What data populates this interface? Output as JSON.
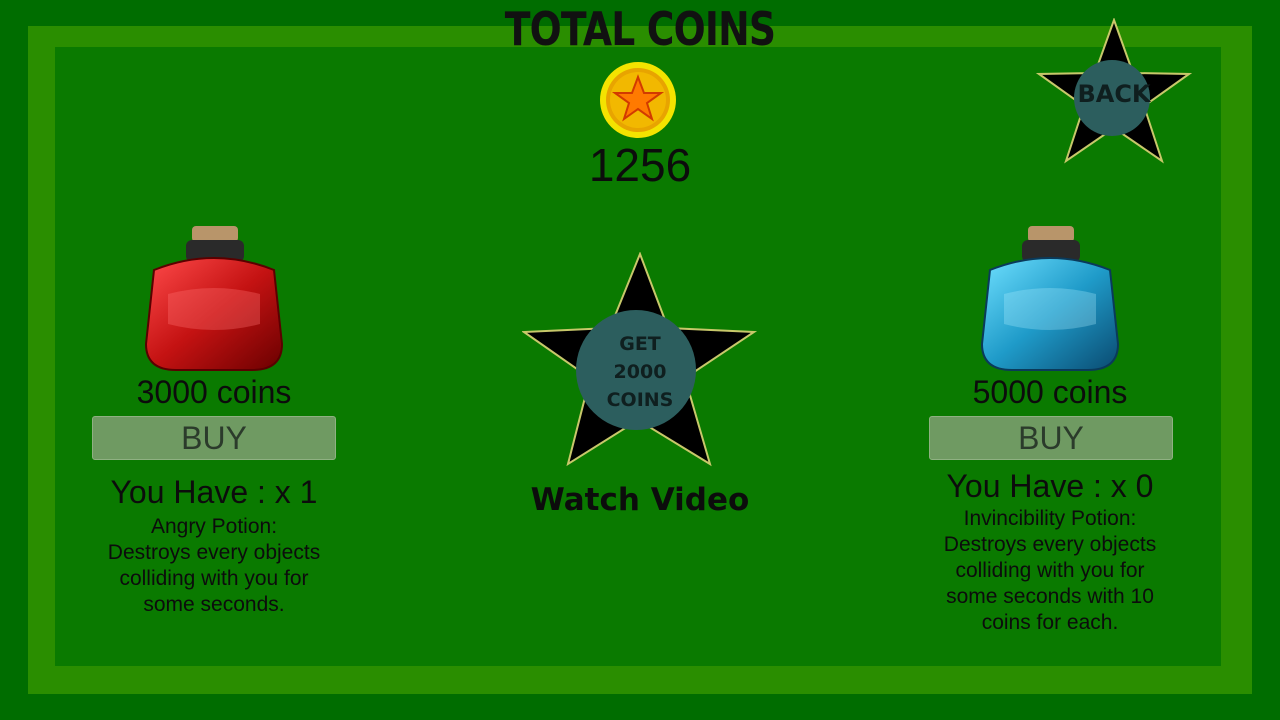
{
  "header": {
    "title": "TOTAL COINS",
    "coin_count": "1256"
  },
  "back_button": {
    "label": "BACK"
  },
  "video_offer": {
    "button_label": "GET\n2000\nCOINS",
    "caption": "Watch Video"
  },
  "shop_items": [
    {
      "price": "3000 coins",
      "buy_label": "BUY",
      "owned": "You Have : x 1",
      "description": "Angry Potion:\nDestroys every objects\ncolliding with you for\nsome seconds.",
      "color": "#c41212",
      "icon": "red-potion-icon"
    },
    {
      "price": "5000 coins",
      "buy_label": "BUY",
      "owned": "You Have : x 0",
      "description": "Invincibility Potion:\nDestroys every objects\ncolliding with you for\nsome seconds with 10\ncoins for each.",
      "color": "#1f9bc9",
      "icon": "blue-potion-icon"
    }
  ],
  "colors": {
    "background": "#006d00",
    "frame": "#2a8e00",
    "panel": "#0a7a00",
    "button": "#6f9a62",
    "star": "#000000",
    "star_center": "#2c5e5e"
  }
}
